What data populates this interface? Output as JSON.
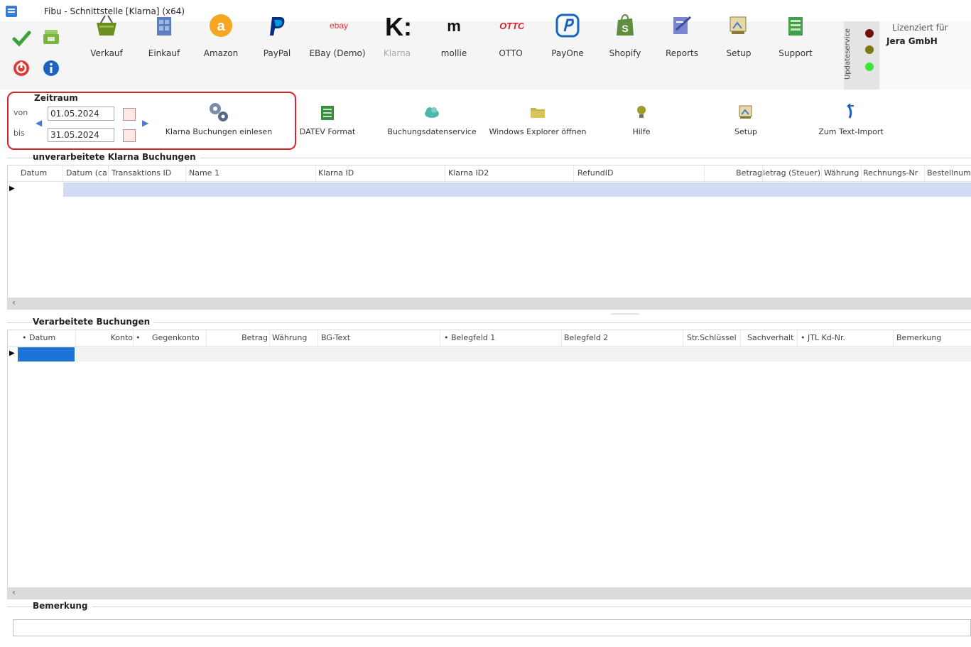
{
  "window": {
    "title": "Fibu - Schnittstelle [Klarna] (x64)"
  },
  "ribbon": {
    "buttons": [
      {
        "label": "Verkauf"
      },
      {
        "label": "Einkauf"
      },
      {
        "label": "Amazon"
      },
      {
        "label": "PayPal"
      },
      {
        "label": "EBay (Demo)"
      },
      {
        "label": "Klarna"
      },
      {
        "label": "mollie"
      },
      {
        "label": "OTTO"
      },
      {
        "label": "PayOne"
      },
      {
        "label": "Shopify"
      },
      {
        "label": "Reports"
      },
      {
        "label": "Setup"
      },
      {
        "label": "Support"
      }
    ],
    "logo_texts": {
      "ebay": "ebay",
      "klarna": "K:",
      "mollie": "m",
      "otto": "OTTO",
      "amazon": "a"
    },
    "update_service": "Updateservice",
    "license": {
      "title": "Lizenziert für",
      "value": "Jera GmbH"
    }
  },
  "zeitraum": {
    "title": "Zeitraum",
    "von_label": "von",
    "bis_label": "bis",
    "von_value": "01.05.2024",
    "bis_value": "31.05.2024",
    "read_button": "Klarna Buchungen einlesen"
  },
  "toolbar2": {
    "buttons": [
      {
        "label": "DATEV Format"
      },
      {
        "label": "Buchungsdatenservice"
      },
      {
        "label": "Windows Explorer öffnen"
      },
      {
        "label": "Hilfe"
      },
      {
        "label": "Setup"
      },
      {
        "label": "Zum Text-Import"
      }
    ]
  },
  "unprocessed": {
    "title": "unverarbeitete Klarna Buchungen",
    "columns": [
      "Datum",
      "Datum (ca",
      "Transaktions ID",
      "Name 1",
      "Klarna ID",
      "Klarna ID2",
      "RefundID",
      "Betrag",
      "Betrag (Steuer)",
      "Währung",
      "Rechnungs-Nr",
      "Bestellnum"
    ]
  },
  "processed": {
    "title": "Verarbeitete Buchungen",
    "columns": [
      "• Datum",
      "Konto",
      "•",
      "Gegenkonto",
      "Betrag",
      "Währung",
      "BG-Text",
      "• Belegfeld 1",
      "Belegfeld 2",
      "Str.Schlüssel",
      "Sachverhalt",
      "• JTL Kd-Nr.",
      "Bemerkung"
    ]
  },
  "bemerkung": {
    "title": "Bemerkung",
    "value": ""
  },
  "colors": {
    "accent_red": "#d6242a",
    "selected_row": "#cfdcf3",
    "selected_cell": "#1e73d8"
  }
}
